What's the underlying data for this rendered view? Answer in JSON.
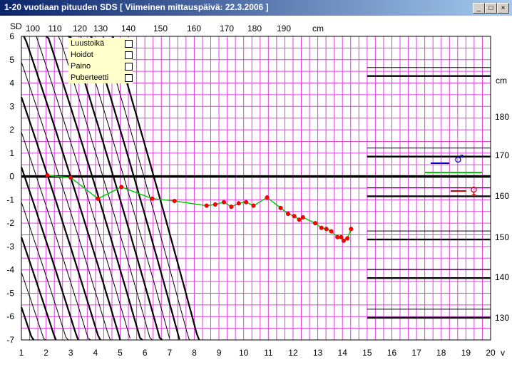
{
  "window": {
    "title": "1-20 vuotiaan pituuden SDS [ Viimeinen mittauspäivä: 22.3.2006 ]",
    "buttons": {
      "minimize": "_",
      "maximize": "□",
      "close": "×"
    }
  },
  "legend": {
    "items": [
      {
        "label": "Luustoikä",
        "checked": false
      },
      {
        "label": "Hoidot",
        "checked": false
      },
      {
        "label": "Paino",
        "checked": false
      },
      {
        "label": "Puberteetti",
        "checked": false
      }
    ]
  },
  "sex_symbols": {
    "male": "♂",
    "female": "♀"
  },
  "chart_data": {
    "type": "line",
    "y_axis": {
      "label": "SD",
      "range": [
        -7,
        6
      ],
      "ticks": [
        6,
        5,
        4,
        3,
        2,
        1,
        0,
        -1,
        -2,
        -3,
        -4,
        -5,
        -6,
        -7
      ]
    },
    "x_axis": {
      "unit": "v",
      "range": [
        1,
        20
      ],
      "ticks": [
        1,
        2,
        3,
        4,
        5,
        6,
        7,
        8,
        9,
        10,
        11,
        12,
        13,
        14,
        15,
        16,
        17,
        18,
        19,
        20
      ]
    },
    "top_axis": {
      "unit": "cm",
      "ticks": [
        100,
        110,
        120,
        130,
        140,
        150,
        160,
        170,
        180,
        190
      ]
    },
    "right_axis": {
      "unit": "cm",
      "ticks": [
        180,
        170,
        160,
        150,
        140,
        130
      ]
    },
    "grid": true,
    "reference_line_sd": 0,
    "series": [
      {
        "color": "#00cc00",
        "marker_color": "#ff0000",
        "points": [
          [
            2.05,
            0.05
          ],
          [
            3.0,
            -0.05
          ],
          [
            4.1,
            -0.95
          ],
          [
            5.05,
            -0.45
          ],
          [
            6.3,
            -0.95
          ],
          [
            7.2,
            -1.05
          ],
          [
            8.5,
            -1.25
          ],
          [
            8.85,
            -1.2
          ],
          [
            9.2,
            -1.1
          ],
          [
            9.5,
            -1.3
          ],
          [
            9.8,
            -1.15
          ],
          [
            10.1,
            -1.1
          ],
          [
            10.4,
            -1.25
          ],
          [
            10.95,
            -0.9
          ],
          [
            11.5,
            -1.35
          ],
          [
            11.8,
            -1.6
          ],
          [
            12.05,
            -1.7
          ],
          [
            12.25,
            -1.85
          ],
          [
            12.4,
            -1.75
          ],
          [
            12.9,
            -2.0
          ],
          [
            13.15,
            -2.2
          ],
          [
            13.35,
            -2.25
          ],
          [
            13.55,
            -2.35
          ],
          [
            13.8,
            -2.6
          ],
          [
            13.95,
            -2.6
          ],
          [
            14.05,
            -2.75
          ],
          [
            14.2,
            -2.65
          ],
          [
            14.35,
            -2.25
          ]
        ]
      }
    ],
    "height_curves_cm": [
      100,
      110,
      120,
      130,
      140,
      150,
      160,
      170,
      180,
      190
    ],
    "adult_height_levels": [
      {
        "cm": 180,
        "sd": 4.3
      },
      {
        "cm": 170,
        "sd": 0.85
      },
      {
        "cm": 160,
        "sd": -0.85
      },
      {
        "cm": 150,
        "sd": -2.7
      },
      {
        "cm": 140,
        "sd": -4.35
      },
      {
        "cm": 130,
        "sd": -6.05
      }
    ]
  }
}
